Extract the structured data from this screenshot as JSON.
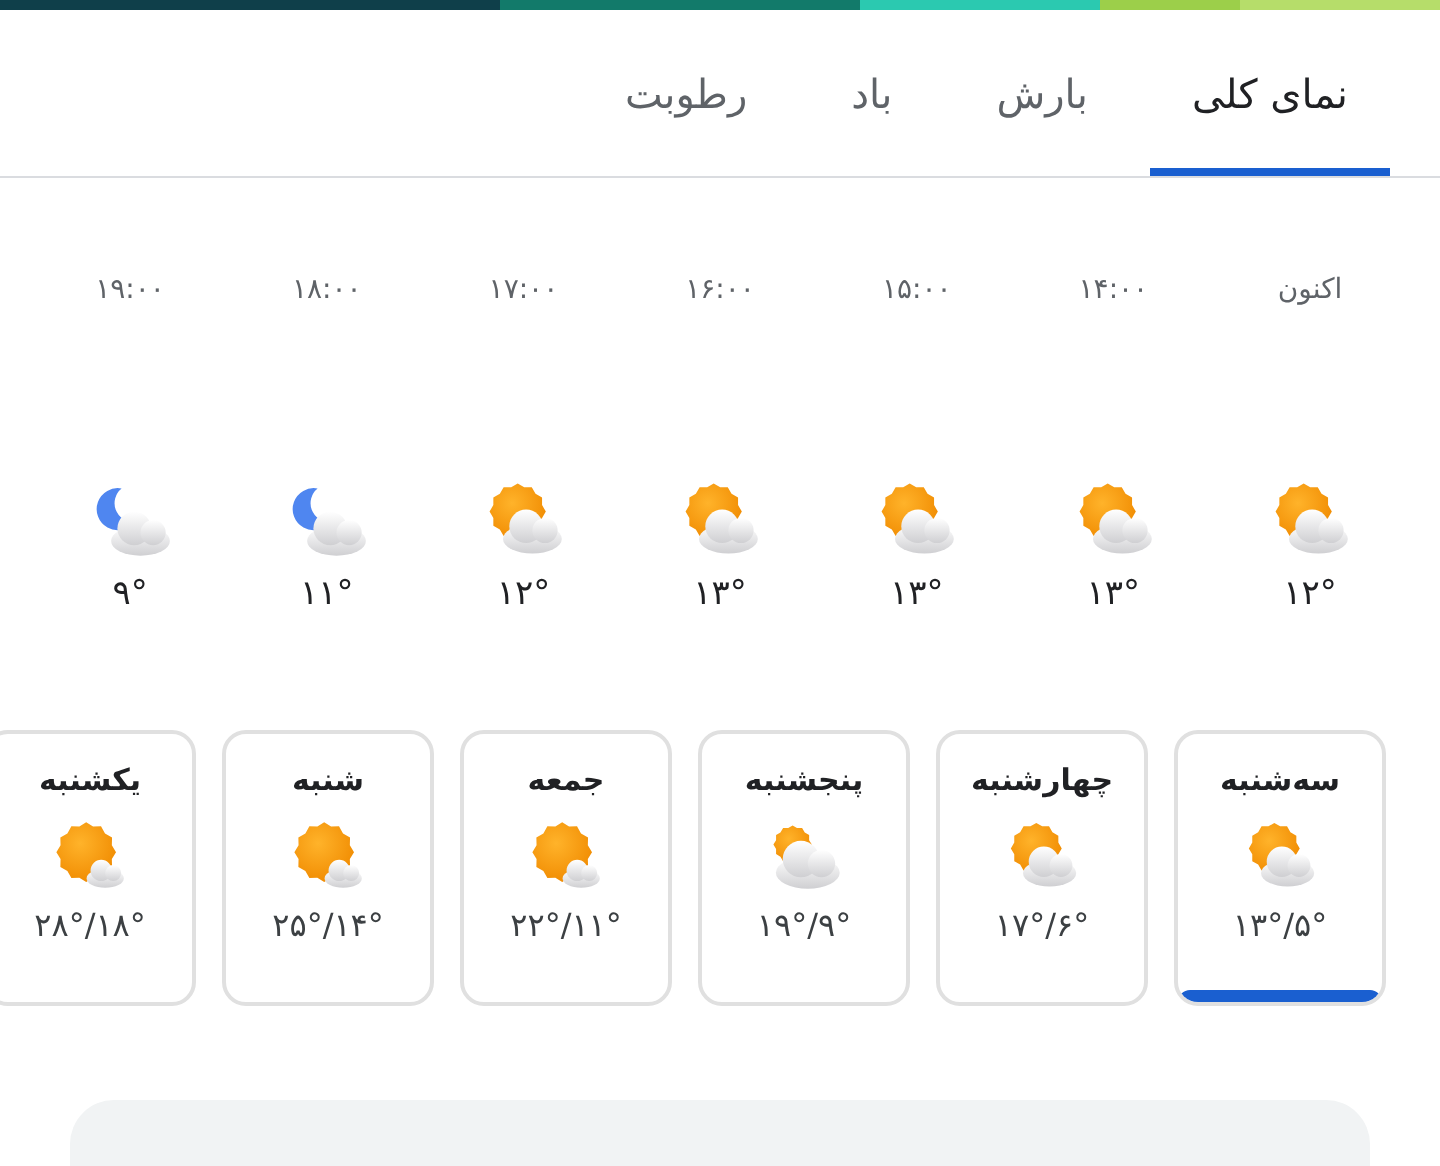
{
  "tabs": [
    {
      "label": "نمای کلی",
      "selected": true
    },
    {
      "label": "بارش",
      "selected": false
    },
    {
      "label": "باد",
      "selected": false
    },
    {
      "label": "رطوبت",
      "selected": false
    }
  ],
  "hours": [
    {
      "time": "اکنون",
      "kind": "sun-cloud",
      "temp": "۱۲°"
    },
    {
      "time": "۱۴:۰۰",
      "kind": "sun-cloud",
      "temp": "۱۳°"
    },
    {
      "time": "۱۵:۰۰",
      "kind": "sun-cloud",
      "temp": "۱۳°"
    },
    {
      "time": "۱۶:۰۰",
      "kind": "sun-cloud",
      "temp": "۱۳°"
    },
    {
      "time": "۱۷:۰۰",
      "kind": "sun-cloud",
      "temp": "۱۲°"
    },
    {
      "time": "۱۸:۰۰",
      "kind": "moon-cloud",
      "temp": "۱۱°"
    },
    {
      "time": "۱۹:۰۰",
      "kind": "moon-cloud",
      "temp": "۹°"
    }
  ],
  "days": [
    {
      "day": "سه‌شنبه",
      "kind": "sun-cloud",
      "temps": "۱۳°/۵°",
      "selected": true
    },
    {
      "day": "چهارشنبه",
      "kind": "sun-cloud",
      "temps": "۱۷°/۶°",
      "selected": false
    },
    {
      "day": "پنجشنبه",
      "kind": "cloud-sun",
      "temps": "۱۹°/۹°",
      "selected": false
    },
    {
      "day": "جمعه",
      "kind": "sun-small-cloud",
      "temps": "۲۲°/۱۱°",
      "selected": false
    },
    {
      "day": "شنبه",
      "kind": "sun-small-cloud",
      "temps": "۲۵°/۱۴°",
      "selected": false
    },
    {
      "day": "یکشنبه",
      "kind": "sun-small-cloud",
      "temps": "۲۸°/۱۸°",
      "selected": false
    }
  ]
}
